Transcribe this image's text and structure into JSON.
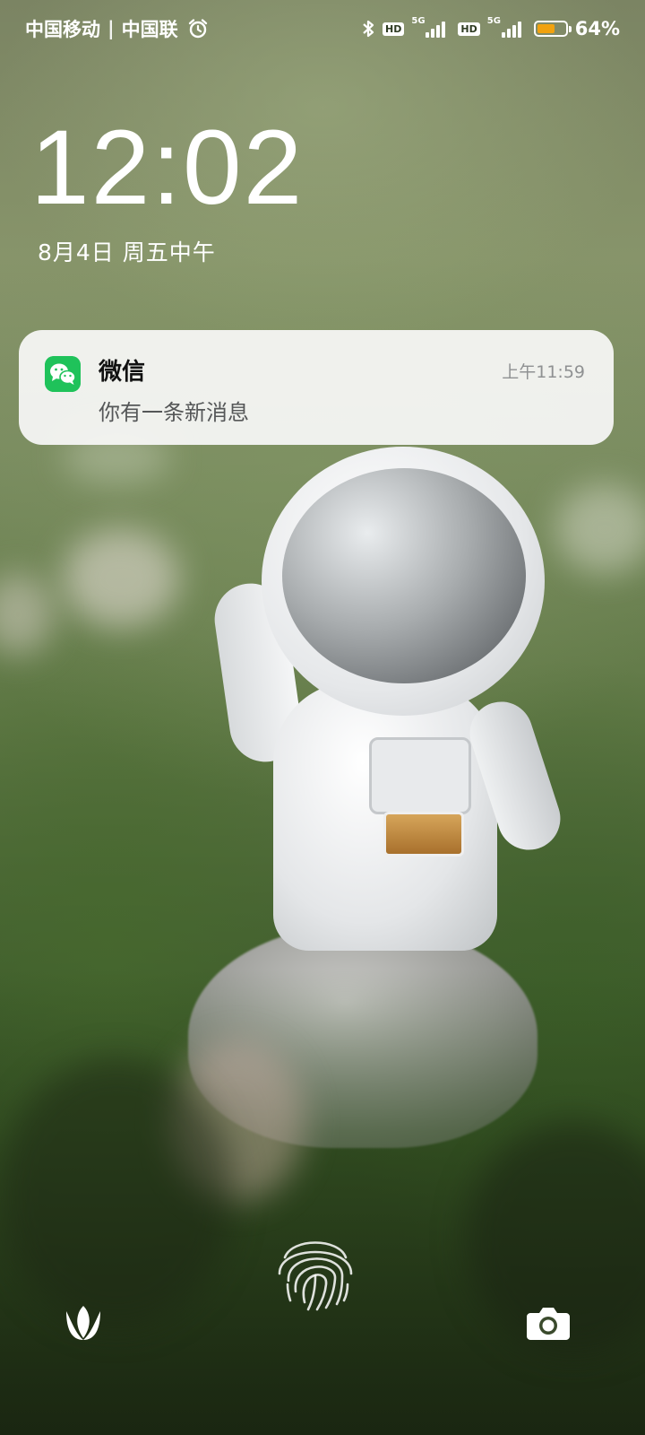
{
  "status_bar": {
    "carrier_1": "中国移动",
    "separator": "|",
    "carrier_2": "中国联",
    "alarm_icon": "alarm-clock-icon",
    "bluetooth_icon": "bluetooth-icon",
    "sim1": {
      "hd": "HD",
      "network": "5G"
    },
    "sim2": {
      "hd": "HD",
      "network": "5G"
    },
    "battery_level": 0.64,
    "battery_color": "#f1a20f",
    "battery_percent": "64%"
  },
  "lock": {
    "time": "12:02",
    "date": "8月4日 周五中午"
  },
  "notification": {
    "app_icon": "wechat-icon",
    "app_color": "#1fc25a",
    "app_name": "微信",
    "time": "上午11:59",
    "message": "你有一条新消息"
  },
  "bottom": {
    "left_icon": "leaf-icon",
    "center_icon": "fingerprint-icon",
    "right_icon": "camera-icon"
  }
}
